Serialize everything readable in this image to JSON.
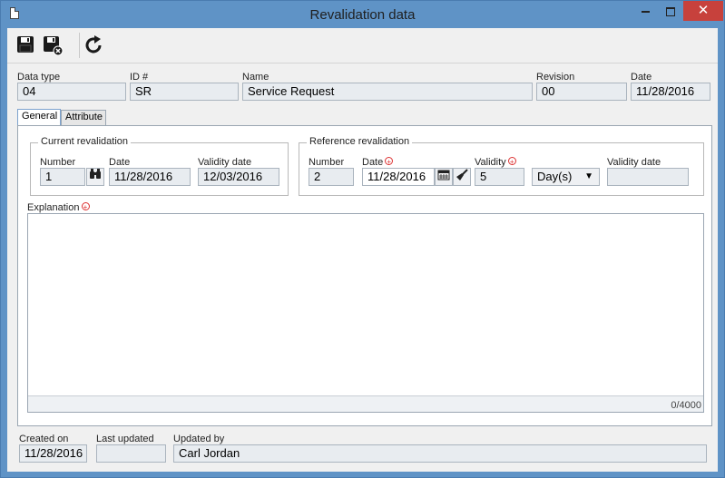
{
  "window": {
    "title": "Revalidation data",
    "close_glyph": "✕"
  },
  "toolbar": {
    "save_icon": "save-icon",
    "save_close_icon": "save-and-close-icon",
    "refresh_icon": "refresh-icon"
  },
  "header": {
    "data_type": {
      "label": "Data type",
      "value": "04"
    },
    "id": {
      "label": "ID #",
      "value": "SR"
    },
    "name": {
      "label": "Name",
      "value": "Service Request"
    },
    "revision": {
      "label": "Revision",
      "value": "00"
    },
    "date": {
      "label": "Date",
      "value": "11/28/2016"
    }
  },
  "tabs": [
    {
      "label": "General",
      "active": true
    },
    {
      "label": "Attribute",
      "active": false
    }
  ],
  "current_revalidation": {
    "title": "Current revalidation",
    "number": {
      "label": "Number",
      "value": "1"
    },
    "date": {
      "label": "Date",
      "value": "11/28/2016"
    },
    "validity_date": {
      "label": "Validity date",
      "value": "12/03/2016"
    }
  },
  "reference_revalidation": {
    "title": "Reference revalidation",
    "number": {
      "label": "Number",
      "value": "2"
    },
    "date": {
      "label": "Date",
      "value": "11/28/2016"
    },
    "validity": {
      "label": "Validity",
      "value": "5"
    },
    "unit": {
      "selected": "Day(s)"
    },
    "validity_date": {
      "label": "Validity date",
      "value": ""
    }
  },
  "explanation": {
    "label": "Explanation",
    "value": "",
    "counter": "0/4000"
  },
  "footer": {
    "created_on": {
      "label": "Created on",
      "value": "11/28/2016"
    },
    "last_updated": {
      "label": "Last updated",
      "value": ""
    },
    "updated_by": {
      "label": "Updated by",
      "value": "Carl Jordan"
    }
  },
  "colors": {
    "titlebar": "#5f93c6",
    "close_button": "#c7413c",
    "required": "#dd3333"
  }
}
